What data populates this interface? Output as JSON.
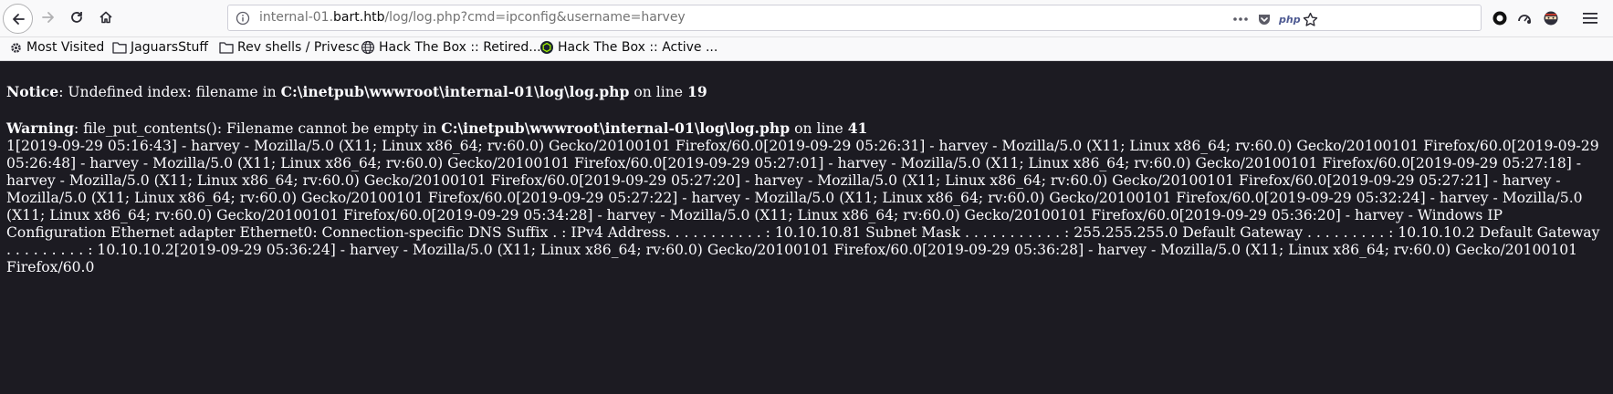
{
  "browser": {
    "url_prefix": "internal-01.",
    "url_host": "bart.htb",
    "url_path": "/log/log.php?cmd=ipconfig&username=harvey",
    "php_badge": "php"
  },
  "bookmarks": [
    {
      "label": "Most Visited",
      "icon": "gear-icon"
    },
    {
      "label": "JaguarsStuff",
      "icon": "folder-icon"
    },
    {
      "label": "Rev shells / Privesc",
      "icon": "folder-icon"
    },
    {
      "label": "Hack The Box :: Retired...",
      "icon": "globe-icon"
    },
    {
      "label": "Hack The Box :: Active ...",
      "icon": "htb-icon"
    }
  ],
  "page": {
    "notice": {
      "label": "Notice",
      "text1": ": Undefined index: filename in ",
      "path": "C:\\inetpub\\wwwroot\\internal-01\\log\\log.php",
      "text2": " on line ",
      "line": "19"
    },
    "warning": {
      "label": "Warning",
      "text1": ": file_put_contents(): Filename cannot be empty in ",
      "path": "C:\\inetpub\\wwwroot\\internal-01\\log\\log.php",
      "text2": " on line ",
      "line": "41"
    },
    "log_text": "1[2019-09-29 05:16:43] - harvey - Mozilla/5.0 (X11; Linux x86_64; rv:60.0) Gecko/20100101 Firefox/60.0[2019-09-29 05:26:31] - harvey - Mozilla/5.0 (X11; Linux x86_64; rv:60.0) Gecko/20100101 Firefox/60.0[2019-09-29 05:26:48] - harvey - Mozilla/5.0 (X11; Linux x86_64; rv:60.0) Gecko/20100101 Firefox/60.0[2019-09-29 05:27:01] - harvey - Mozilla/5.0 (X11; Linux x86_64; rv:60.0) Gecko/20100101 Firefox/60.0[2019-09-29 05:27:18] - harvey - Mozilla/5.0 (X11; Linux x86_64; rv:60.0) Gecko/20100101 Firefox/60.0[2019-09-29 05:27:20] - harvey - Mozilla/5.0 (X11; Linux x86_64; rv:60.0) Gecko/20100101 Firefox/60.0[2019-09-29 05:27:21] - harvey - Mozilla/5.0 (X11; Linux x86_64; rv:60.0) Gecko/20100101 Firefox/60.0[2019-09-29 05:27:22] - harvey - Mozilla/5.0 (X11; Linux x86_64; rv:60.0) Gecko/20100101 Firefox/60.0[2019-09-29 05:32:24] - harvey - Mozilla/5.0 (X11; Linux x86_64; rv:60.0) Gecko/20100101 Firefox/60.0[2019-09-29 05:34:28] - harvey - Mozilla/5.0 (X11; Linux x86_64; rv:60.0) Gecko/20100101 Firefox/60.0[2019-09-29 05:36:20] - harvey - Windows IP Configuration Ethernet adapter Ethernet0: Connection-specific DNS Suffix . : IPv4 Address. . . . . . . . . . . : 10.10.10.81 Subnet Mask . . . . . . . . . . . : 255.255.255.0 Default Gateway . . . . . . . . . : 10.10.10.2 Default Gateway . . . . . . . . . : 10.10.10.2[2019-09-29 05:36:24] - harvey - Mozilla/5.0 (X11; Linux x86_64; rv:60.0) Gecko/20100101 Firefox/60.0[2019-09-29 05:36:28] - harvey - Mozilla/5.0 (X11; Linux x86_64; rv:60.0) Gecko/20100101 Firefox/60.0"
  }
}
